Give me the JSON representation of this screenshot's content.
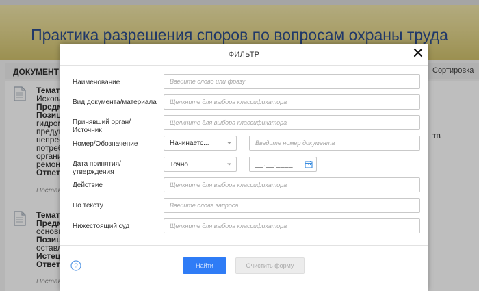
{
  "banner": {
    "title": "Практика разрешения споров по вопросам охраны труда"
  },
  "doc_header": {
    "title": "ДОКУМЕНТ",
    "sort_label": "Сортировка"
  },
  "doc_items": [
    {
      "lines": [
        {
          "bold": "Темати",
          "text": ""
        },
        {
          "bold": "",
          "text": "Исковa"
        },
        {
          "bold": "Предм",
          "text": ""
        },
        {
          "bold": "Позици",
          "text": ""
        },
        {
          "bold": "",
          "text": "гидром"
        },
        {
          "bold": "",
          "text": "предуп"
        },
        {
          "bold": "",
          "text": "непрес"
        },
        {
          "bold": "",
          "text": "потреб"
        },
        {
          "bold": "",
          "text": "органи"
        },
        {
          "bold": "",
          "text": "ремонт"
        },
        {
          "bold": "Ответч",
          "text": ""
        }
      ],
      "footer": "Постан",
      "side_text": "тв"
    },
    {
      "lines": [
        {
          "bold": "Темати",
          "text": ""
        },
        {
          "bold": "Предм",
          "text": ""
        },
        {
          "bold": "",
          "text": "основн"
        },
        {
          "bold": "Позици",
          "text": ""
        },
        {
          "bold": "",
          "text": "оставл"
        },
        {
          "bold": "Истец:",
          "text": ""
        },
        {
          "bold": "Ответч",
          "text": ""
        }
      ],
      "footer": "Постан"
    }
  ],
  "modal": {
    "title": "ФИЛЬТР",
    "fields": {
      "name": {
        "label": "Наименование",
        "placeholder": "Введите слово или фразу"
      },
      "doc_type": {
        "label": "Вид документа/материала",
        "placeholder": "Щелкните для выбора классификатора"
      },
      "authority": {
        "label_line1": "Принявший орган/",
        "label_line2": "Источник",
        "placeholder": "Щелкните для выбора классификатора"
      },
      "number": {
        "label": "Номер/Обозначение",
        "select_value": "Начинаетс...",
        "placeholder": "Введите номер документа"
      },
      "date": {
        "label_line1": "Дата принятия/",
        "label_line2": "утверждения",
        "select_value": "Точно",
        "placeholder": "__.__.____"
      },
      "action": {
        "label": "Действие",
        "placeholder": "Щелкните для выбора классификатора"
      },
      "text": {
        "label": "По тексту",
        "placeholder": "Введите слова запроса"
      },
      "lower_court": {
        "label": "Нижестоящий суд",
        "placeholder": "Щелкните для выбора классификатора"
      }
    },
    "buttons": {
      "find": "Найти",
      "clear": "Очистить форму"
    }
  },
  "icons": [
    "document-icon",
    "close-icon",
    "chevron-down-icon",
    "calendar-icon",
    "help-icon"
  ],
  "colors": {
    "accent": "#2f7cf6",
    "banner_text": "#1d3f86",
    "banner_bg": "#e2d488"
  }
}
